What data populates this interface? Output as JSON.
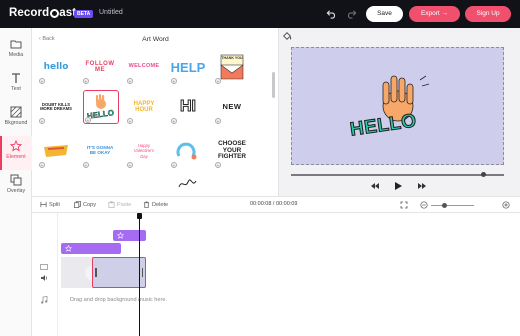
{
  "app": {
    "logo_left": "Record",
    "logo_right": "ast",
    "beta_badge": "BETA",
    "doc_title": "Untitled",
    "save_label": "Save",
    "export_label": "Export",
    "export_arrow": "→",
    "signup_label": "Sign Up",
    "brand_color": "#f0506e"
  },
  "rail": {
    "items": [
      {
        "label": "Media",
        "icon": "folder-icon"
      },
      {
        "label": "Text",
        "icon": "text-icon"
      },
      {
        "label": "Bkground",
        "icon": "background-icon"
      },
      {
        "label": "Element",
        "icon": "star-icon",
        "active": true
      },
      {
        "label": "Overlay",
        "icon": "overlay-icon"
      }
    ]
  },
  "panel": {
    "back_label": "Back",
    "title": "Art Word",
    "stickers": {
      "hello_lower": "hello",
      "follow_me": "FOLLOW ME",
      "welcome": "WELCOME",
      "help": "HELP",
      "thank_you": "THANK YOU",
      "doubt_kills": "DOUBT KILLS MORE DREAMS",
      "hello_selected": "HELLO",
      "happy_hour": "HAPPY HOUR",
      "hi": "HI",
      "new": "NEW",
      "its_gonna": "IT'S GONNA BE OKAY",
      "valentine": "Happy Valentine's Day",
      "choose_fighter": "CHOOSE YOUR FIGHTER"
    }
  },
  "preview": {
    "art_word": "HELLO"
  },
  "timeline": {
    "split_label": "Split",
    "copy_label": "Copy",
    "paste_label": "Paste",
    "delete_label": "Delete",
    "timecode": "00:00:08 / 00:00:09",
    "audio_hint": "Drag and drop background music here."
  }
}
